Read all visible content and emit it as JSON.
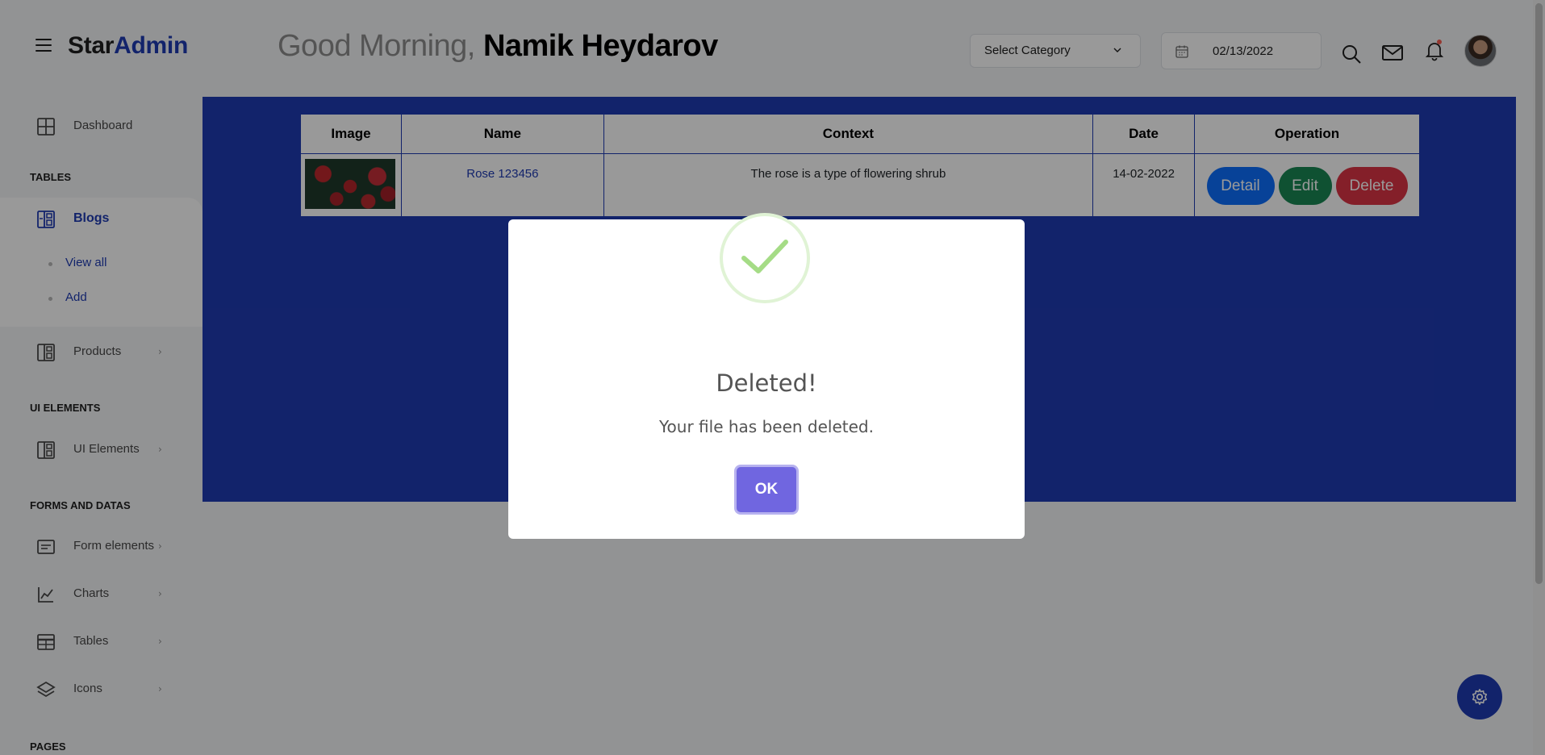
{
  "header": {
    "logo_part1": "Star",
    "logo_part2": "Admin",
    "greeting": "Good Morning,",
    "user_name": "Namik Heydarov",
    "category_placeholder": "Select Category",
    "date": "02/13/2022"
  },
  "sidebar": {
    "dashboard": "Dashboard",
    "cat_tables": "TABLES",
    "blogs": "Blogs",
    "view_all": "View all",
    "add": "Add",
    "products": "Products",
    "cat_ui": "UI ELEMENTS",
    "ui_elements": "UI Elements",
    "cat_forms": "FORMS AND DATAS",
    "form_elements": "Form elements",
    "charts": "Charts",
    "tables": "Tables",
    "icons": "Icons",
    "cat_pages": "PAGES",
    "arrow": "›"
  },
  "table": {
    "headers": [
      "Image",
      "Name",
      "Context",
      "Date",
      "Operation"
    ],
    "rows": [
      {
        "name": "Rose 123456",
        "context": "The rose is a type of flowering shrub",
        "date": "14-02-2022"
      }
    ],
    "buttons": {
      "detail": "Detail",
      "edit": "Edit",
      "delete": "Delete"
    }
  },
  "modal": {
    "title": "Deleted!",
    "text": "Your file has been deleted.",
    "ok": "OK"
  },
  "colors": {
    "brand": "#1f3bb3",
    "detail": "#0d6efd",
    "edit": "#198754",
    "delete": "#dc3545",
    "ok": "#7066e0",
    "success": "#a5dc86"
  }
}
